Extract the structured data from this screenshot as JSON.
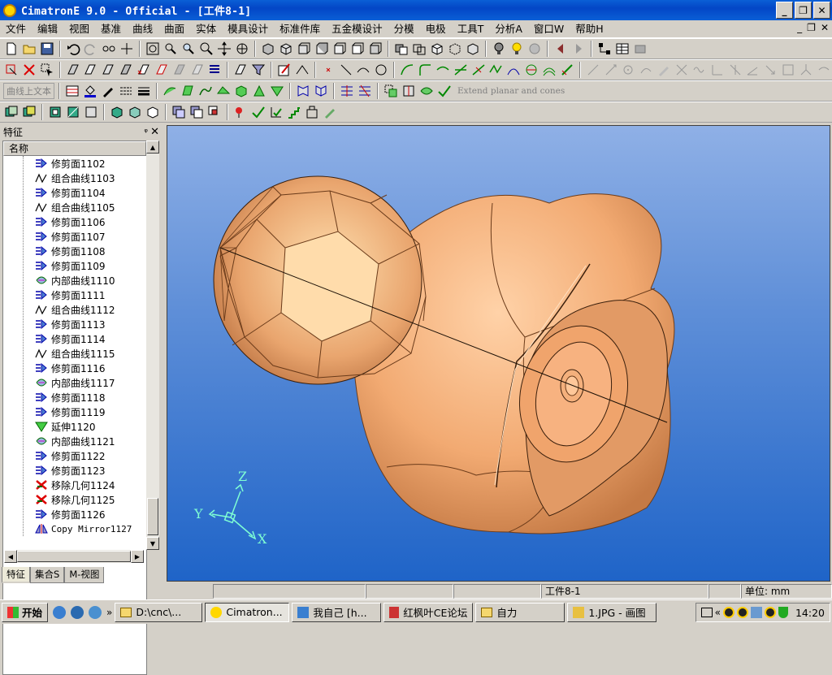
{
  "window": {
    "title": "CimatronE 9.0 - Official - [工件8-1]"
  },
  "menu": [
    "文件",
    "编辑",
    "视图",
    "基准",
    "曲线",
    "曲面",
    "实体",
    "模具设计",
    "标准件库",
    "五金模设计",
    "分模",
    "电极",
    "工具T",
    "分析A",
    "窗口W",
    "帮助H"
  ],
  "toolbar": {
    "curve_text_label": "曲线上文本",
    "extend_label": "Extend planar and cones"
  },
  "panel": {
    "title": "特征",
    "column_header": "名称",
    "tabs": [
      "特征",
      "集合S",
      "M-视图"
    ],
    "items": [
      {
        "label": "修剪面1102",
        "icon": "trim-face-icon"
      },
      {
        "label": "组合曲线1103",
        "icon": "composite-curve-icon"
      },
      {
        "label": "修剪面1104",
        "icon": "trim-face-icon"
      },
      {
        "label": "组合曲线1105",
        "icon": "composite-curve-icon"
      },
      {
        "label": "修剪面1106",
        "icon": "trim-face-icon"
      },
      {
        "label": "修剪面1107",
        "icon": "trim-face-icon"
      },
      {
        "label": "修剪面1108",
        "icon": "trim-face-icon"
      },
      {
        "label": "修剪面1109",
        "icon": "trim-face-icon"
      },
      {
        "label": "内部曲线1110",
        "icon": "internal-curve-icon"
      },
      {
        "label": "修剪面1111",
        "icon": "trim-face-icon"
      },
      {
        "label": "组合曲线1112",
        "icon": "composite-curve-icon"
      },
      {
        "label": "修剪面1113",
        "icon": "trim-face-icon"
      },
      {
        "label": "修剪面1114",
        "icon": "trim-face-icon"
      },
      {
        "label": "组合曲线1115",
        "icon": "composite-curve-icon"
      },
      {
        "label": "修剪面1116",
        "icon": "trim-face-icon"
      },
      {
        "label": "内部曲线1117",
        "icon": "internal-curve-icon"
      },
      {
        "label": "修剪面1118",
        "icon": "trim-face-icon"
      },
      {
        "label": "修剪面1119",
        "icon": "trim-face-icon"
      },
      {
        "label": "延伸1120",
        "icon": "extend-icon"
      },
      {
        "label": "内部曲线1121",
        "icon": "internal-curve-icon"
      },
      {
        "label": "修剪面1122",
        "icon": "trim-face-icon"
      },
      {
        "label": "修剪面1123",
        "icon": "trim-face-icon"
      },
      {
        "label": "移除几何1124",
        "icon": "remove-geometry-icon"
      },
      {
        "label": "移除几何1125",
        "icon": "remove-geometry-icon"
      },
      {
        "label": "修剪面1126",
        "icon": "trim-face-icon"
      },
      {
        "label": "Copy Mirror1127",
        "icon": "copy-mirror-icon"
      }
    ]
  },
  "viewport": {
    "axes": {
      "x": "X",
      "y": "Y",
      "z": "Z"
    }
  },
  "status": {
    "part": "工件8-1",
    "unit": "单位: mm"
  },
  "taskbar": {
    "start": "开始",
    "tasks": [
      "D:\\cnc\\...",
      "Cimatron...",
      "我自己 [h...",
      "红枫叶CE论坛",
      "自力",
      "1.JPG - 画图"
    ],
    "clock": "14:20"
  },
  "colors": {
    "title": "#0a5fd6",
    "model": "#f2aa72",
    "viewport_top": "#8fb0e6",
    "viewport_bottom": "#1f64c8",
    "axis": "#7fffd4"
  }
}
